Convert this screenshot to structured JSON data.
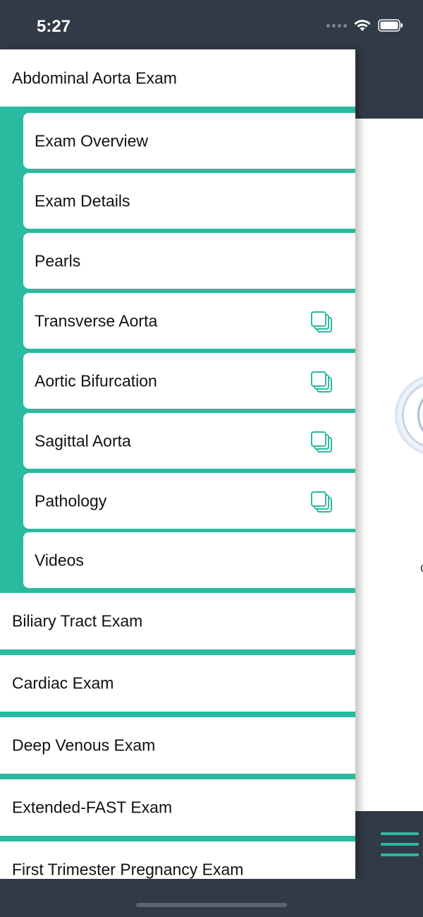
{
  "status_bar": {
    "time": "5:27"
  },
  "drawer": {
    "expanded_section": {
      "label": "Abdominal Aorta Exam"
    },
    "sub_items": [
      {
        "label": "Exam Overview",
        "icon": ""
      },
      {
        "label": "Exam Details",
        "icon": ""
      },
      {
        "label": "Pearls",
        "icon": ""
      },
      {
        "label": "Transverse Aorta",
        "icon": "gallery-icon"
      },
      {
        "label": "Aortic Bifurcation",
        "icon": "gallery-icon"
      },
      {
        "label": "Sagittal Aorta",
        "icon": "gallery-icon"
      },
      {
        "label": "Pathology",
        "icon": "gallery-icon"
      },
      {
        "label": "Videos",
        "icon": ""
      }
    ],
    "sections": [
      {
        "label": "Biliary Tract Exam"
      },
      {
        "label": "Cardiac Exam"
      },
      {
        "label": "Deep Venous Exam"
      },
      {
        "label": "Extended-FAST Exam"
      },
      {
        "label": "First Trimester Pregnancy Exam"
      }
    ]
  },
  "colors": {
    "accent": "#2abaa0",
    "dark": "#313a46",
    "background": "#ffffff"
  }
}
